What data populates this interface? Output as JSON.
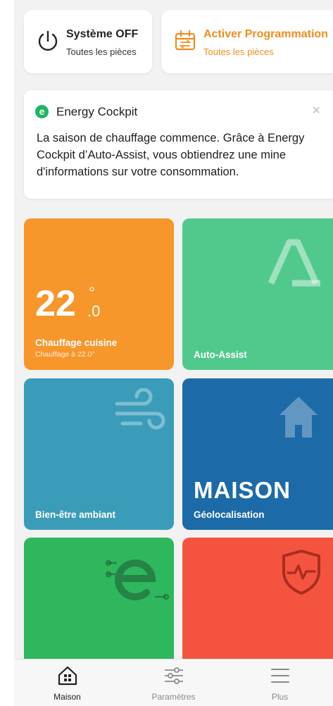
{
  "quick_actions": {
    "system": {
      "title": "Système OFF",
      "subtitle": "Toutes les pièces",
      "icon": "power-icon"
    },
    "schedule": {
      "title": "Activer Programmation",
      "subtitle": "Toutes les pièces",
      "icon": "calendar-icon",
      "color": "#ef8d1c"
    }
  },
  "banner": {
    "logo_letter": "e",
    "title": "Energy Cockpit",
    "close": "×",
    "text": "La saison de chauffage commence. Grâce à Energy Cockpit d’Auto-Assist, vous obtiendrez une mine d'informations sur votre consommation."
  },
  "tiles": {
    "chauffage": {
      "temp_int": "22",
      "temp_sup": "°",
      "temp_dec": ".0",
      "label": "Chauffage cuisine",
      "sub": "Chauffage à 22.0°",
      "color": "#f7962b"
    },
    "auto_assist": {
      "label": "Auto-Assist",
      "icon": "auto-assist-logo-icon",
      "color": "#52c98c"
    },
    "bien_etre": {
      "label": "Bien-être ambiant",
      "icon": "wind-icon",
      "color": "#3b9cb9"
    },
    "geoloc": {
      "word": "MAISON",
      "label": "Géolocalisation",
      "icon": "house-icon",
      "color": "#1d6aa8"
    },
    "energy": {
      "icon": "energy-e-icon",
      "color": "#2eb75d"
    },
    "sante": {
      "icon": "shield-pulse-icon",
      "color": "#f4543f"
    }
  },
  "bottom_nav": {
    "items": [
      {
        "label": "Maison",
        "icon": "home-icon",
        "active": true
      },
      {
        "label": "Paramètres",
        "icon": "sliders-icon",
        "active": false
      },
      {
        "label": "Plus",
        "icon": "menu-icon",
        "active": false
      }
    ]
  }
}
